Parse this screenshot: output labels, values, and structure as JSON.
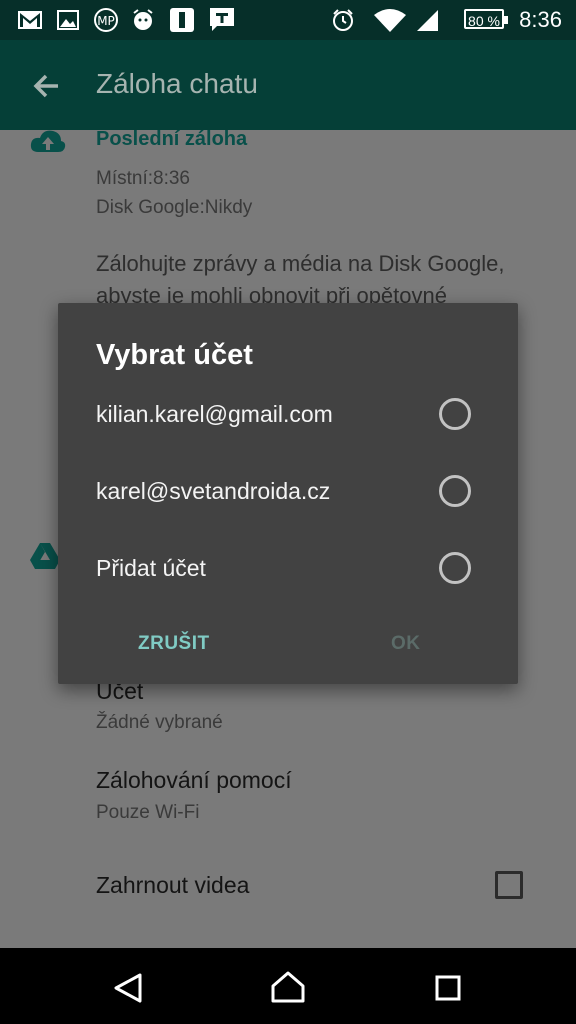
{
  "status_bar": {
    "icons": [
      "gmail-icon",
      "gallery-icon",
      "missed-call-icon",
      "alarm-clock-icon",
      "notification-app-icon",
      "messaging-app-icon",
      "alarm-icon",
      "wifi-icon",
      "cell-signal-icon"
    ],
    "battery": "80 %",
    "time": "8:36"
  },
  "app_bar": {
    "title": "Záloha chatu"
  },
  "background": {
    "last_backup_title": "Poslední záloha",
    "local": "Místní:8:36",
    "google_disk": "Disk Google:Nikdy",
    "description_line1": "Zálohujte zprávy a média na Disk Google,",
    "description_line2": "abyste je mohli obnovit při opětovné",
    "account_label": "Účet",
    "account_value": "Žádné vybrané",
    "backup_over_label": "Zálohování pomocí",
    "backup_over_value": "Pouze Wi-Fi",
    "include_videos_label": "Zahrnout videa"
  },
  "dialog": {
    "title": "Vybrat účet",
    "options": [
      {
        "label": "kilian.karel@gmail.com"
      },
      {
        "label": "karel@svetandroida.cz"
      },
      {
        "label": "Přidat účet"
      }
    ],
    "cancel_label": "ZRUŠIT",
    "ok_label": "OK"
  },
  "colors": {
    "status_bar": "#062f29",
    "app_bar": "#053f37",
    "accent": "#80cbc4",
    "dialog_bg": "#424242"
  }
}
